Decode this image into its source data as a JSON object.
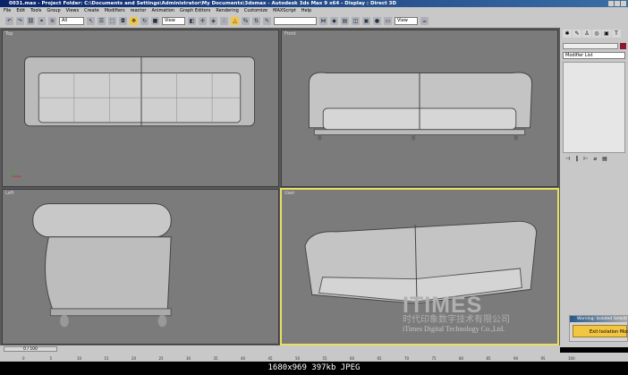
{
  "window": {
    "title": "0031.max    - Project Folder: C:\\Documents and Settings\\Administrator\\My Documents\\3dsmax    - Autodesk 3ds Max 9 x64    - Display : Direct 3D"
  },
  "menu": [
    "File",
    "Edit",
    "Tools",
    "Group",
    "Views",
    "Create",
    "Modifiers",
    "reactor",
    "Animation",
    "Graph Editors",
    "Rendering",
    "Customize",
    "MAXScript",
    "Help"
  ],
  "toolbar": {
    "selection_filter": "All",
    "ref_coord": "View",
    "ref_coord2": "View",
    "named_sel": ""
  },
  "viewports": [
    {
      "label": "Top"
    },
    {
      "label": "Front"
    },
    {
      "label": "Left"
    },
    {
      "label": "User",
      "active": true
    }
  ],
  "command_panel": {
    "modifier_list": "Modifier List",
    "object_color": "#8b1a2e"
  },
  "warning": {
    "title": "Warning: Isolated Selection",
    "button": "Exit Isolation Mode"
  },
  "timeline": {
    "frame": "0 / 100",
    "ticks": [
      "0",
      "5",
      "10",
      "15",
      "20",
      "25",
      "30",
      "35",
      "40",
      "45",
      "50",
      "55",
      "60",
      "65",
      "70",
      "75",
      "80",
      "85",
      "90",
      "95",
      "100"
    ]
  },
  "watermark": {
    "brand": "ITIMES",
    "cn": "时代印象数字技术有限公司",
    "en": "iTimes Digital Technology Co.,Ltd."
  },
  "caption": "1680x969 397kb JPEG"
}
